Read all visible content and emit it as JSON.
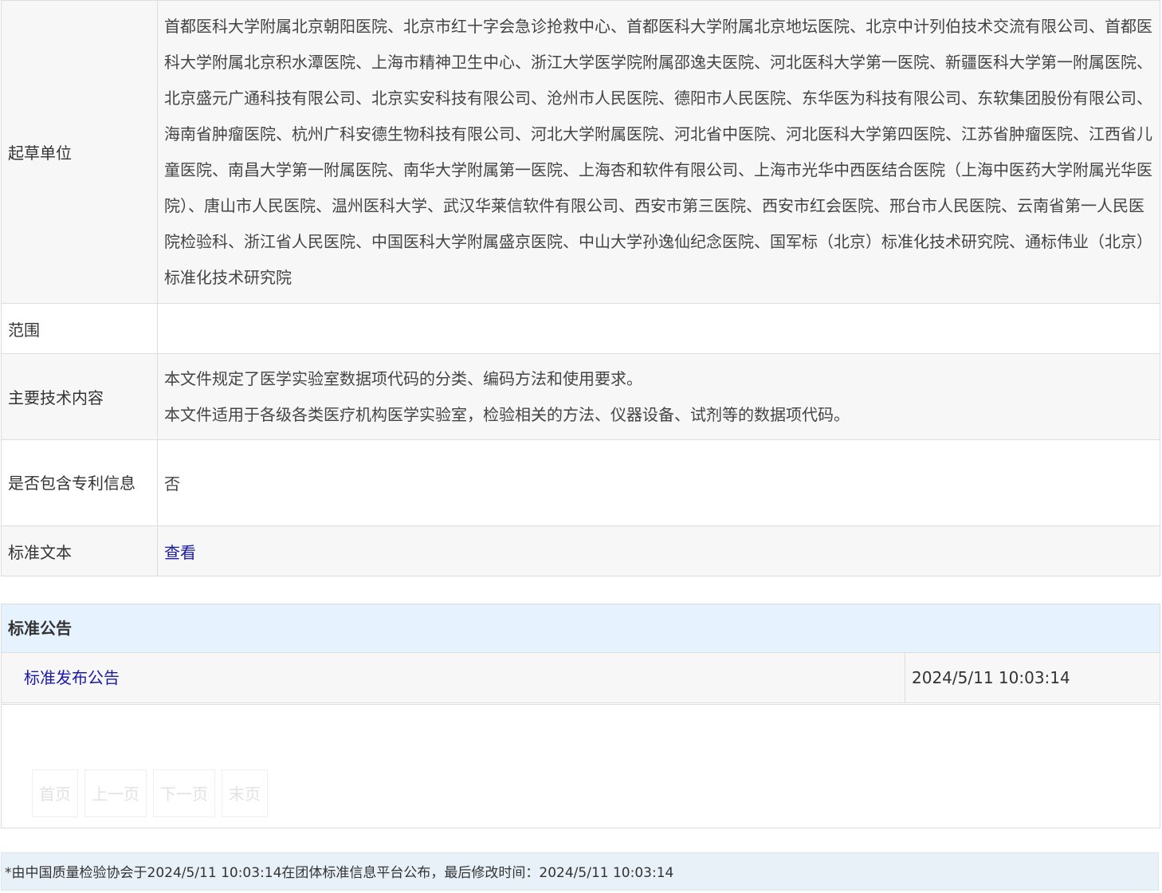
{
  "details": {
    "drafters": {
      "label": "起草单位",
      "value": "首都医科大学附属北京朝阳医院、北京市红十字会急诊抢救中心、首都医科大学附属北京地坛医院、北京中计列伯技术交流有限公司、首都医科大学附属北京积水潭医院、上海市精神卫生中心、浙江大学医学院附属邵逸夫医院、河北医科大学第一医院、新疆医科大学第一附属医院、北京盛元广通科技有限公司、北京实安科技有限公司、沧州市人民医院、德阳市人民医院、东华医为科技有限公司、东软集团股份有限公司、海南省肿瘤医院、杭州广科安德生物科技有限公司、河北大学附属医院、河北省中医院、河北医科大学第四医院、江苏省肿瘤医院、江西省儿童医院、南昌大学第一附属医院、南华大学附属第一医院、上海杏和软件有限公司、上海市光华中西医结合医院（上海中医药大学附属光华医院）、唐山市人民医院、温州医科大学、武汉华莱信软件有限公司、西安市第三医院、西安市红会医院、邢台市人民医院、云南省第一人民医院检验科、浙江省人民医院、中国医科大学附属盛京医院、中山大学孙逸仙纪念医院、国军标（北京）标准化技术研究院、通标伟业（北京）标准化技术研究院"
    },
    "scope": {
      "label": "范围",
      "value": ""
    },
    "tech": {
      "label": "主要技术内容",
      "line1": "本文件规定了医学实验室数据项代码的分类、编码方法和使用要求。",
      "line2": "本文件适用于各级各类医疗机构医学实验室，检验相关的方法、仪器设备、试剂等的数据项代码。"
    },
    "patent": {
      "label": "是否包含专利信息",
      "value": "否"
    },
    "text": {
      "label": "标准文本",
      "link": "查看"
    }
  },
  "announcements": {
    "header": "标准公告",
    "items": [
      {
        "title": "标准发布公告",
        "date": "2024/5/11 10:03:14"
      }
    ]
  },
  "pager": {
    "first": "首页",
    "prev": "上一页",
    "next": "下一页",
    "last": "末页"
  },
  "footer": {
    "note": "*由中国质量检验协会于2024/5/11 10:03:14在团体标准信息平台公布，最后修改时间：2024/5/11 10:03:14"
  }
}
